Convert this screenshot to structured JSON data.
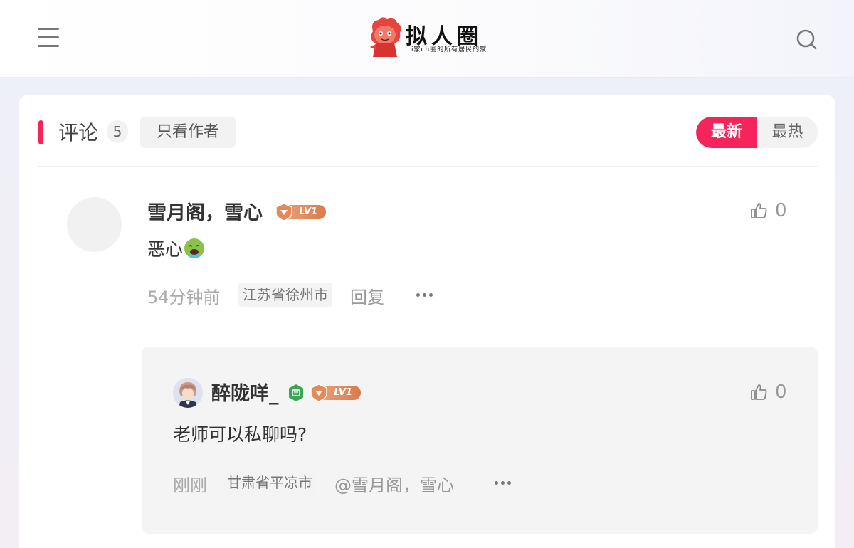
{
  "header": {
    "logo_title": "拟人圈",
    "logo_subtitle": "i家ch圈的所有居民的家"
  },
  "comments_section": {
    "title": "评论",
    "count": "5",
    "author_only_label": "只看作者",
    "sort_options": [
      "最新",
      "最热"
    ],
    "active_sort": "最新",
    "accent_color": "#f5245a"
  },
  "comment": {
    "username": "雪月阁，雪心",
    "level": "LV1",
    "likes": "0",
    "text": "恶心",
    "emoji": "nauseated-face-icon",
    "time": "54分钟前",
    "location": "江苏省徐州市",
    "reply_label": "回复"
  },
  "reply": {
    "username": "醉陇咩_",
    "level": "LV1",
    "likes": "0",
    "text": "老师可以私聊吗?",
    "time": "刚刚",
    "location": "甘肃省平凉市",
    "mention": "@雪月阁，雪心"
  }
}
